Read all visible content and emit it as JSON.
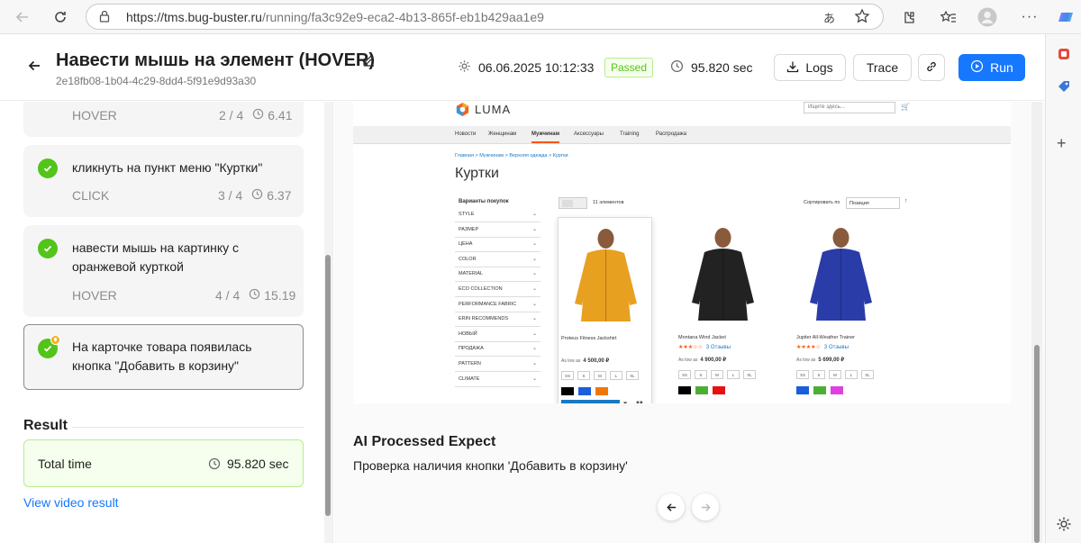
{
  "browser": {
    "url_host": "https://tms.bug-buster.ru",
    "url_path": "/running/fa3c92e9-eca2-4b13-865f-eb1b429aa1e9"
  },
  "header": {
    "title": "Навести мышь на элемент (HOVER)",
    "run_id": "2e18fb08-1b04-4c29-8dd4-5f91e9d93a30",
    "date": "06.06.2025 10:12:33",
    "status": "Passed",
    "duration": "95.820 sec",
    "logs_label": "Logs",
    "trace_label": "Trace",
    "run_label": "Run"
  },
  "steps": [
    {
      "text": "",
      "action": "HOVER",
      "progress": "2 / 4",
      "time": "6.41"
    },
    {
      "text": "кликнуть на пункт меню \"Куртки\"",
      "action": "CLICK",
      "progress": "3 / 4",
      "time": "6.37"
    },
    {
      "text_line1": "навести мышь на картинку с",
      "text_line2": "оранжевой курткой",
      "action": "HOVER",
      "progress": "4 / 4",
      "time": "15.19"
    }
  ],
  "expect": {
    "line1": "На карточке товара появилась",
    "line2": "кнопка \"Добавить в корзину\""
  },
  "result": {
    "title": "Result",
    "total_label": "Total time",
    "total_value": "95.820 sec",
    "video_link": "View video result"
  },
  "ai": {
    "title": "AI Processed Expect",
    "text": "Проверка наличия кнопки 'Добавить в корзину'"
  },
  "shop": {
    "logo": "LUMA",
    "search_placeholder": "Ищите здесь...",
    "nav": [
      "Новости",
      "Женщинам",
      "Мужчинам",
      "Аксессуары",
      "Training",
      "Распродажа"
    ],
    "breadcrumbs": "Главная  >  Мужчинам  >  Верхняя одежда  >  Куртки",
    "category_title": "Куртки",
    "filter_title": "Варианты покупок",
    "filters": [
      "STYLE",
      "РАЗМЕР",
      "ЦЕНА",
      "COLOR",
      "MATERIAL",
      "ECO COLLECTION",
      "PERFORMANCE FABRIC",
      "ERIN RECOMMENDS",
      "НОВЫЙ",
      "ПРОДАЖА",
      "PATTERN",
      "CLIMATE"
    ],
    "item_count": "11 элементов",
    "sort_label": "Сортировать по",
    "sort_value": "Позиция",
    "add_to_cart": "Добавить в корзину",
    "products": [
      {
        "name": "Proteus Fitness Jackshirt",
        "stars": "",
        "reviews": "",
        "price_prefix": "As low as",
        "price": "4 500,00 ₽",
        "jacket": "#e8a020",
        "colors": [
          "#000000",
          "#1a5ed8",
          "#f07800"
        ]
      },
      {
        "name": "Montana Wind Jacket",
        "stars": "★★★☆☆",
        "reviews": "3  Отзывы",
        "price_prefix": "As low as",
        "price": "4 900,00 ₽",
        "jacket": "#222222",
        "colors": [
          "#000000",
          "#4caf34",
          "#e81010"
        ]
      },
      {
        "name": "Jupiter All-Weather Trainer",
        "stars": "★★★★☆",
        "reviews": "3  Отзывы",
        "price_prefix": "As low as",
        "price": "5 699,00 ₽",
        "jacket": "#2a3ca8",
        "colors": [
          "#1a5ed8",
          "#4caf34",
          "#e040e0"
        ]
      }
    ],
    "sizes": [
      "XS",
      "S",
      "M",
      "L",
      "XL"
    ]
  },
  "icons": {
    "back": "arrow-left-icon",
    "edit": "pencil-icon",
    "settings": "gear-icon",
    "clock": "clock-icon",
    "download": "download-icon",
    "link": "link-icon",
    "play": "play-circle-icon",
    "check": "check-circle-icon"
  },
  "colors": {
    "accent": "#1677ff",
    "success": "#52c41a",
    "success_bg": "#f6ffed"
  }
}
